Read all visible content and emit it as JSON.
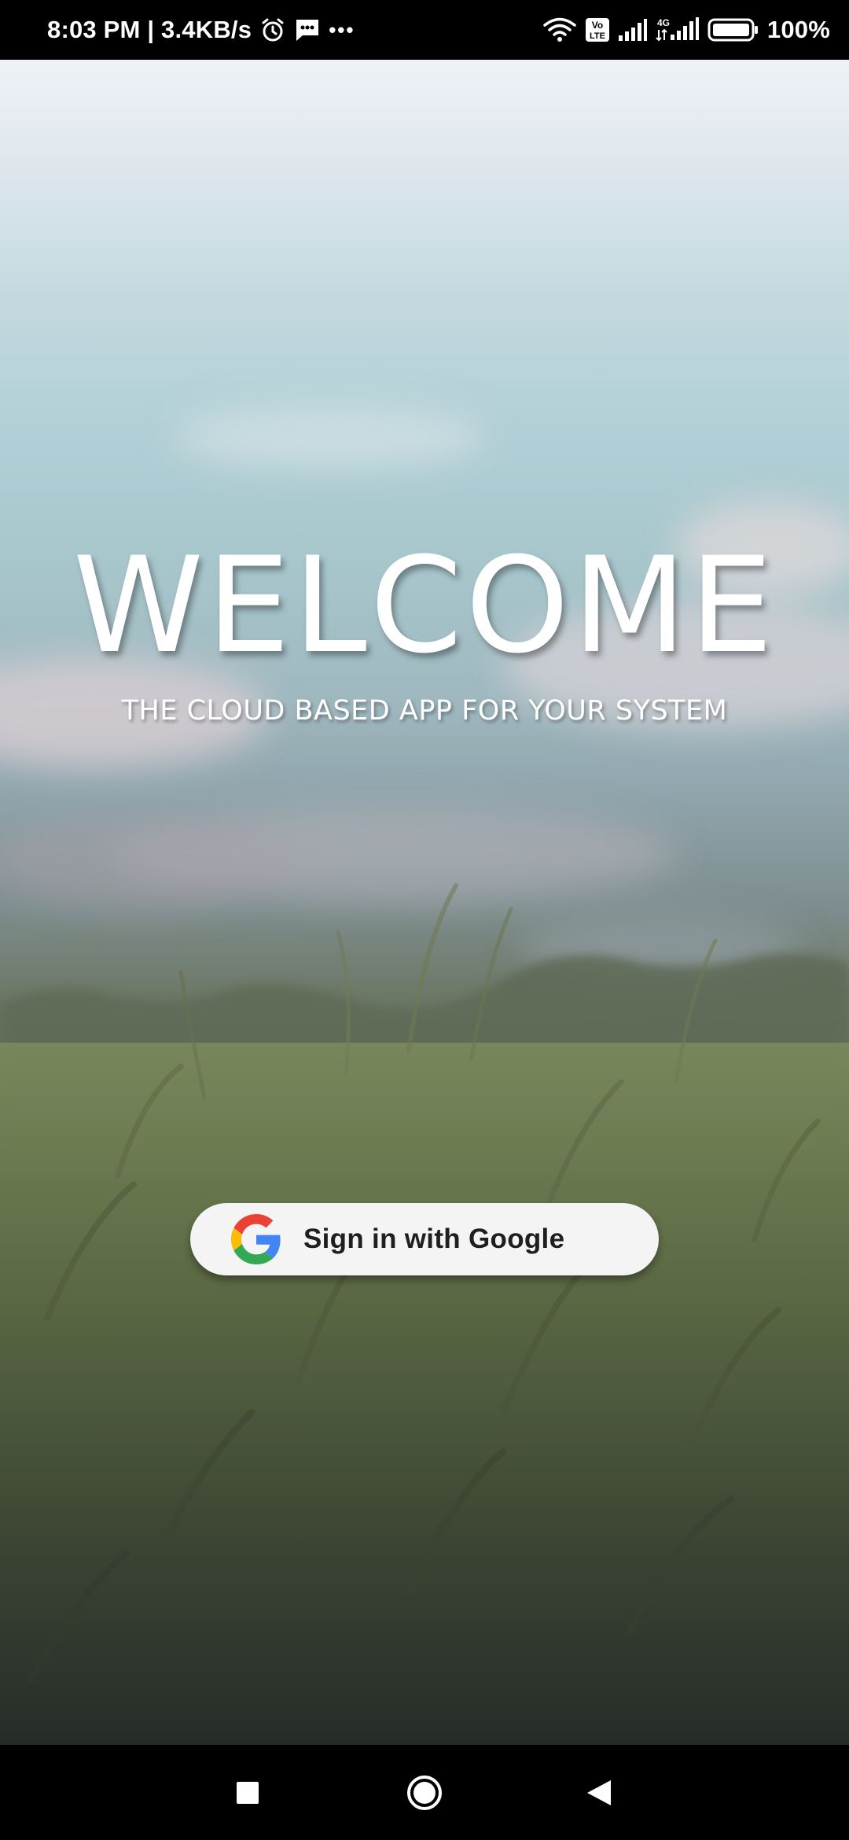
{
  "status_bar": {
    "time_and_speed": "8:03 PM | 3.4KB/s",
    "more_indicator": "•••",
    "battery_percent": "100%",
    "icons_left": [
      "alarm-icon",
      "message-icon",
      "more-dots-icon"
    ],
    "icons_right": [
      "wifi-icon",
      "volte-icon",
      "signal-icon",
      "4g-signal-icon",
      "battery-icon"
    ],
    "volte_label_top": "Vo",
    "volte_label_bottom": "LTE",
    "network_label": "4G"
  },
  "welcome": {
    "title": "WELCOME",
    "subtitle": "THE CLOUD BASED APP FOR YOUR SYSTEM"
  },
  "sign_in": {
    "label": "Sign in with Google",
    "icon": "google-logo-icon"
  },
  "nav_bar": {
    "buttons": [
      "recents-square-icon",
      "home-circle-icon",
      "back-triangle-icon"
    ]
  },
  "colors": {
    "google_blue": "#4285F4",
    "google_red": "#EA4335",
    "google_yellow": "#FBBC05",
    "google_green": "#34A853",
    "button_bg": "#f4f4f4",
    "text_white": "#ffffff"
  }
}
